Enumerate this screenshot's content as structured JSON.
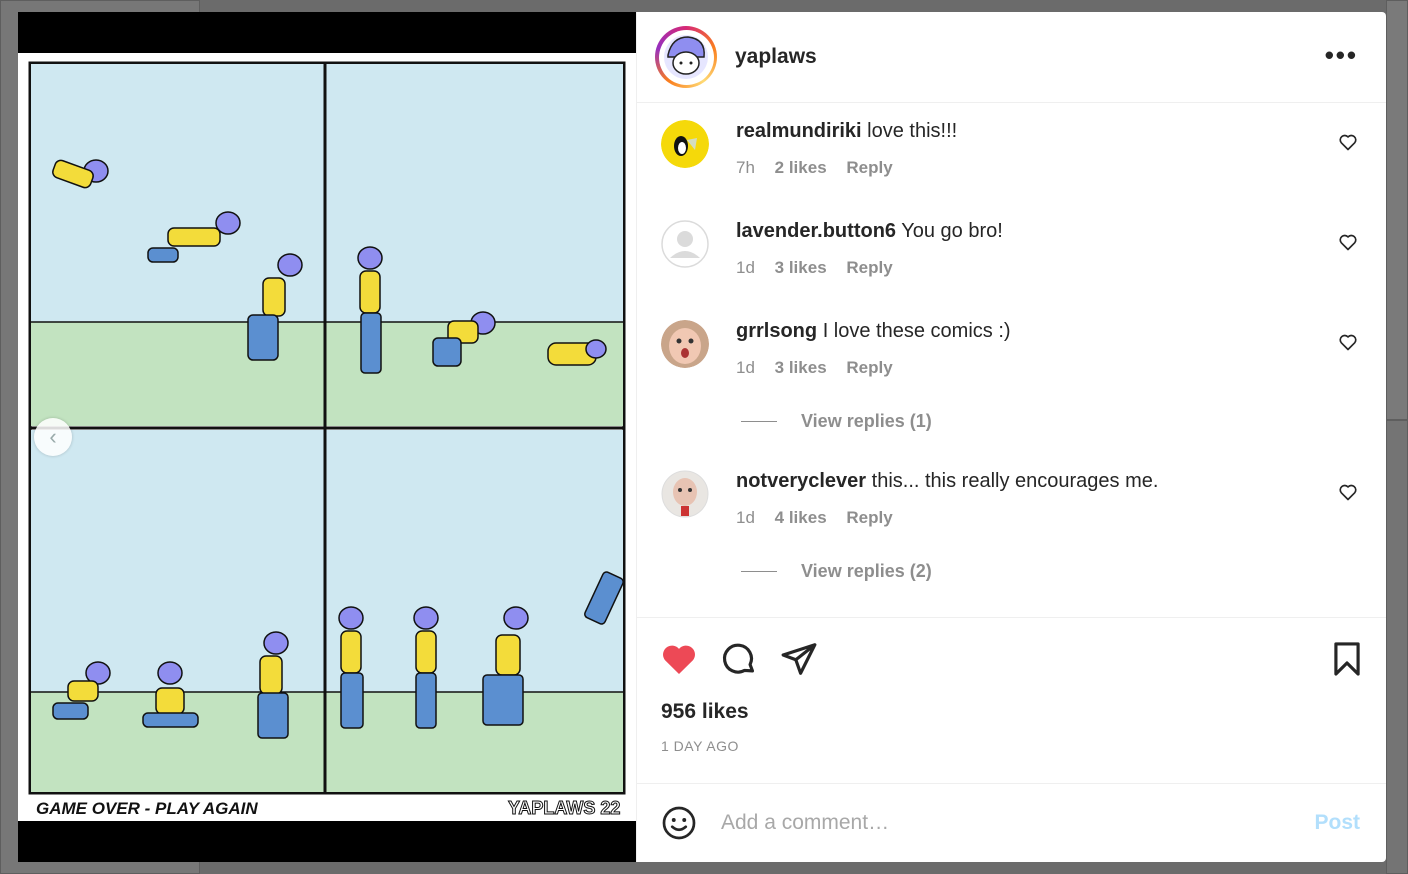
{
  "post": {
    "username": "yaplaws",
    "more_icon": "more-icon"
  },
  "comic": {
    "caption": "GAME OVER - PLAY AGAIN",
    "signature": "YAPLAWS 22"
  },
  "comments": [
    {
      "username": "realmundiriki",
      "text": "love this!!!",
      "time": "7h",
      "likes": "2 likes",
      "reply": "Reply"
    },
    {
      "username": "lavender.button6",
      "text": "You go bro!",
      "time": "1d",
      "likes": "3 likes",
      "reply": "Reply"
    },
    {
      "username": "grrlsong",
      "text": "I love these comics :)",
      "time": "1d",
      "likes": "3 likes",
      "reply": "Reply",
      "view_replies": "View replies (1)"
    },
    {
      "username": "notveryclever",
      "text": "this... this really encourages me.",
      "time": "1d",
      "likes": "4 likes",
      "reply": "Reply",
      "view_replies": "View replies (2)"
    }
  ],
  "actions": {
    "likes": "956 likes",
    "time_ago": "1 DAY AGO",
    "liked_color": "#ed4956"
  },
  "add_comment": {
    "placeholder": "Add a comment…",
    "post_label": "Post"
  }
}
